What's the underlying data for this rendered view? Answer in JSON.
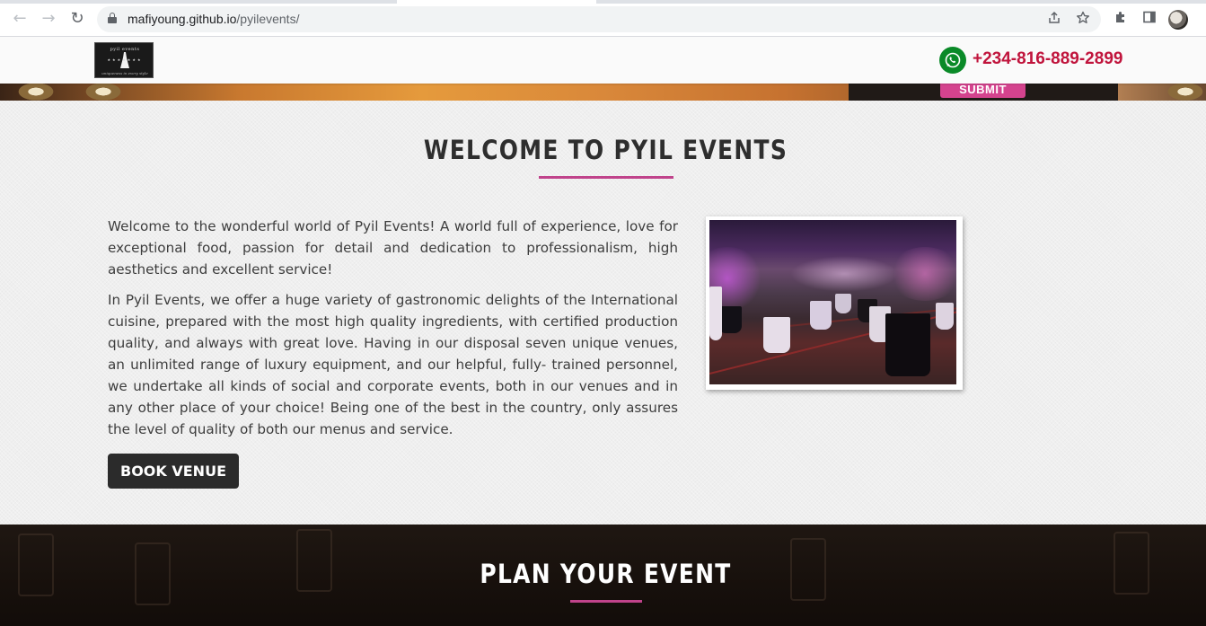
{
  "browser": {
    "url_host": "mafiyoung.github.io",
    "url_path": "/pyilevents/",
    "icons": [
      "back-icon",
      "forward-icon",
      "reload-icon",
      "lock-icon",
      "share-icon",
      "star-icon",
      "extensions-icon",
      "sidepanel-icon",
      "profile-avatar"
    ]
  },
  "header": {
    "logo": {
      "top_text": "pyil events",
      "tagline": "uniqueness in every style"
    },
    "phone": "+234-816-889-2899",
    "whatsapp_icon": "whatsapp-icon"
  },
  "hero": {
    "submit_label": "SUBMIT"
  },
  "welcome": {
    "title": "WELCOME TO PYIL EVENTS",
    "paragraphs": [
      "Welcome to the wonderful world of Pyil Events! A world full of experience, love for exceptional food, passion for detail and dedication to professionalism, high aesthetics and excellent service!",
      "In Pyil Events, we offer a huge variety of gastronomic delights of the International cuisine, prepared with the most high quality ingredients, with certified production quality, and always with great love. Having in our disposal seven unique venues, an unlimited range of luxury equipment, and our helpful, fully- trained personnel, we undertake all kinds of social and corporate events, both in our venues and in any other place of your choice! Being one of the best in the country, only assures the level of quality of both our menus and service."
    ],
    "book_button": "BOOK VENUE"
  },
  "plan": {
    "title": "PLAN YOUR EVENT"
  },
  "colors": {
    "accent_pink": "#c0438b",
    "phone_red": "#c0143c",
    "whatsapp_green": "#0a8a28",
    "dark_button": "#2b2b2b"
  }
}
